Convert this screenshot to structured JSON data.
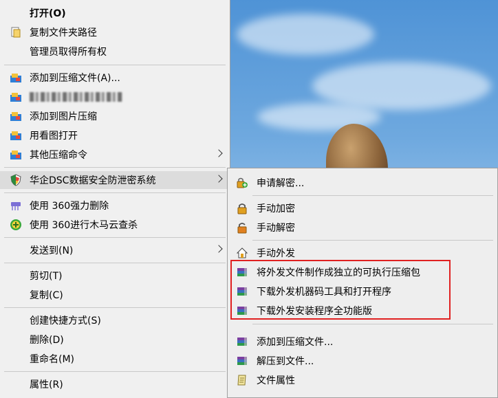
{
  "main_menu": {
    "items": [
      {
        "label": "打开(O)",
        "icon": "none"
      },
      {
        "label": "复制文件夹路径",
        "icon": "copy-path-icon"
      },
      {
        "label": "管理员取得所有权",
        "icon": "none"
      },
      {
        "label": "添加到压缩文件(A)...",
        "icon": "archive-icon"
      },
      {
        "label": "",
        "icon": "archive-icon"
      },
      {
        "label": "添加到图片压缩",
        "icon": "archive-icon"
      },
      {
        "label": "用看图打开",
        "icon": "archive-icon"
      },
      {
        "label": "其他压缩命令",
        "icon": "archive-icon"
      },
      {
        "label": "华企DSC数据安全防泄密系统",
        "icon": "shield-icon"
      },
      {
        "label": "使用 360强力删除",
        "icon": "shredder-icon"
      },
      {
        "label": "使用 360进行木马云查杀",
        "icon": "plus-circle-icon"
      },
      {
        "label": "发送到(N)",
        "icon": "none"
      },
      {
        "label": "剪切(T)",
        "icon": "none"
      },
      {
        "label": "复制(C)",
        "icon": "none"
      },
      {
        "label": "创建快捷方式(S)",
        "icon": "none"
      },
      {
        "label": "删除(D)",
        "icon": "none"
      },
      {
        "label": "重命名(M)",
        "icon": "none"
      },
      {
        "label": "属性(R)",
        "icon": "none"
      }
    ]
  },
  "sub_menu": {
    "items": [
      {
        "label": "申请解密...",
        "icon": "apply-decrypt-icon"
      },
      {
        "label": "手动加密",
        "icon": "lock-icon"
      },
      {
        "label": "手动解密",
        "icon": "unlock-icon"
      },
      {
        "label": "手动外发",
        "icon": "house-send-icon"
      },
      {
        "label": "将外发文件制作成独立的可执行压缩包",
        "icon": "books-icon"
      },
      {
        "label": "下载外发机器码工具和打开程序",
        "icon": "books-icon"
      },
      {
        "label": "下载外发安装程序全功能版",
        "icon": "books-icon"
      },
      {
        "label": "添加到压缩文件...",
        "icon": "books-icon"
      },
      {
        "label": "解压到文件...",
        "icon": "books-icon"
      },
      {
        "label": "文件属性",
        "icon": "scroll-icon"
      }
    ]
  },
  "colors": {
    "highlight_box": "#e02020",
    "menu_bg": "#f0f0f0",
    "hover_bg": "#dcdcdc"
  }
}
